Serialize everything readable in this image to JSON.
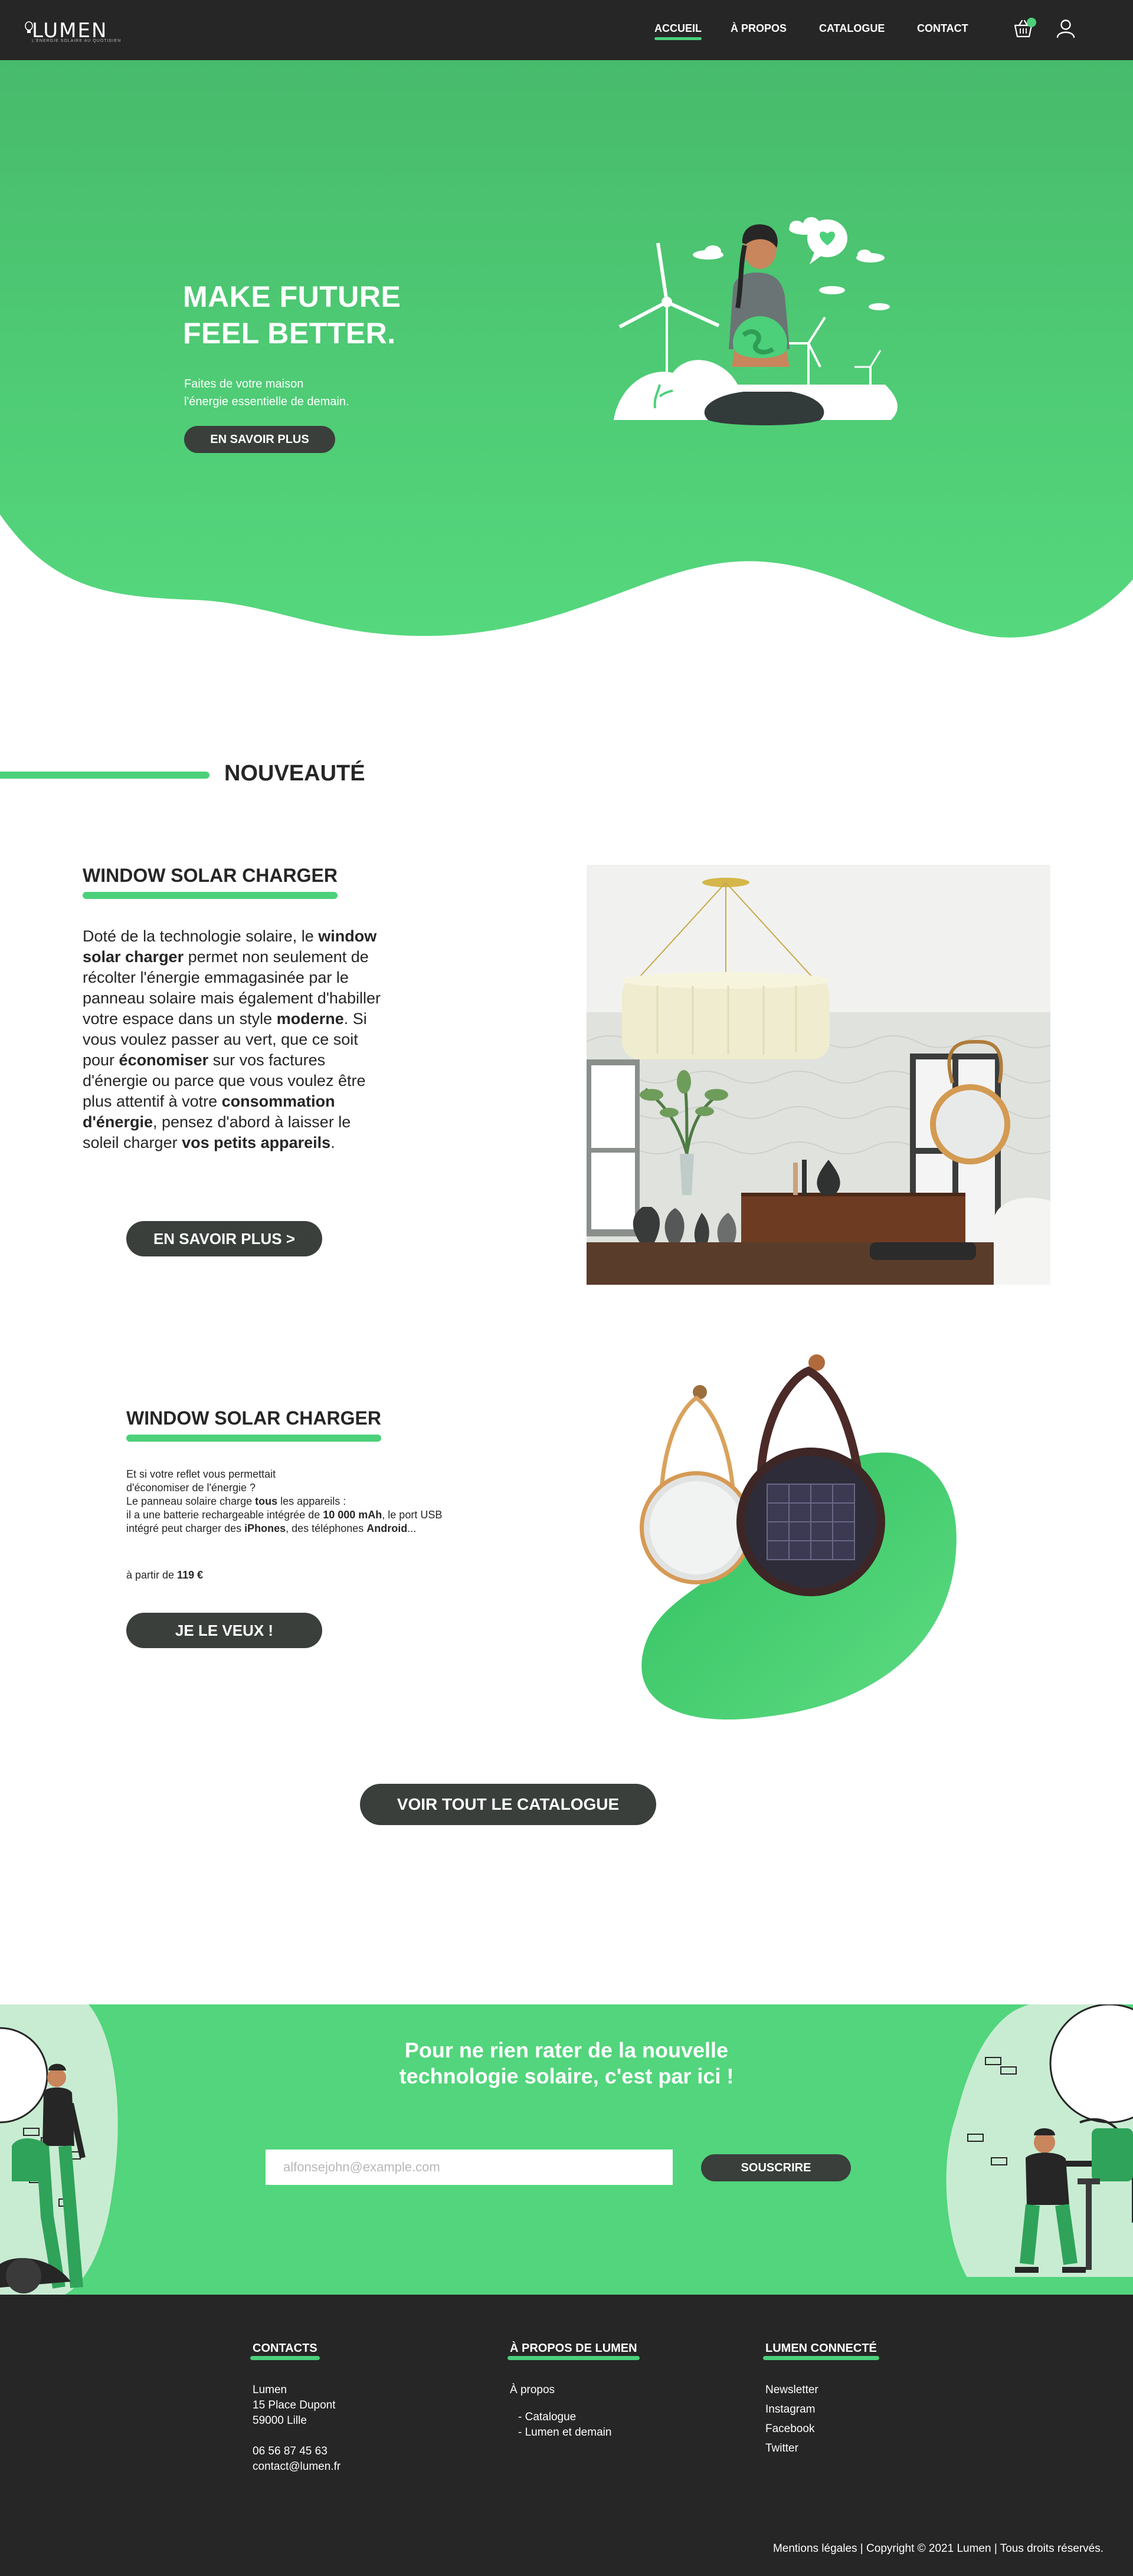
{
  "nav": {
    "logo_text": "LUMEN",
    "logo_tagline": "L'ÉNERGIE SOLAIRE AU QUOTIDIEN",
    "links": [
      "ACCUEIL",
      "À PROPOS",
      "CATALOGUE",
      "CONTACT"
    ],
    "active_link": "ACCUEIL",
    "cart_icon": "basket-icon",
    "user_icon": "user-icon"
  },
  "hero": {
    "title_line1": "MAKE FUTURE",
    "title_line2": "FEEL BETTER.",
    "subtitle_line1": "Faites de votre maison",
    "subtitle_line2": "l'énergie essentielle de demain.",
    "cta": "EN SAVOIR PLUS",
    "illustration": "woman-holding-globe-with-wind-turbines-illustration"
  },
  "section": {
    "title": "NOUVEAUTÉ"
  },
  "product1": {
    "title": "WINDOW SOLAR CHARGER",
    "desc": [
      {
        "t": "Doté de la technologie solaire, le ",
        "b": false
      },
      {
        "t": "window solar charger",
        "b": true
      },
      {
        "t": " permet non seulement de récolter l'énergie emmagasinée par le panneau solaire mais également d'habiller votre espace dans un style ",
        "b": false
      },
      {
        "t": "moderne",
        "b": true
      },
      {
        "t": ". Si vous voulez passer au vert, que ce soit pour ",
        "b": false
      },
      {
        "t": "économiser",
        "b": true
      },
      {
        "t": " sur vos factures d'énergie ou parce que vous voulez être plus attentif à votre ",
        "b": false
      },
      {
        "t": "consommation d'énergie",
        "b": true
      },
      {
        "t": ", pensez d'abord à laisser le soleil charger ",
        "b": false
      },
      {
        "t": "vos petits appareils",
        "b": true
      },
      {
        "t": ".",
        "b": false
      }
    ],
    "cta": "EN SAVOIR PLUS >",
    "photo": "interior-room-with-pendant-lamp-and-round-mirror-photo"
  },
  "product2": {
    "title": "WINDOW SOLAR CHARGER",
    "desc": [
      {
        "t": "Et si votre reflet vous permettait",
        "b": false,
        "br": true
      },
      {
        "t": "d'économiser de l'énergie ?",
        "b": false,
        "br": true
      },
      {
        "t": "Le panneau solaire charge ",
        "b": false
      },
      {
        "t": "tous",
        "b": true
      },
      {
        "t": " les appareils :",
        "b": false,
        "br": true
      },
      {
        "t": "il a une batterie rechargeable intégrée de ",
        "b": false
      },
      {
        "t": "10 000 mAh",
        "b": true
      },
      {
        "t": ", le port USB",
        "b": false,
        "br": true
      },
      {
        "t": "intégré peut charger des ",
        "b": false
      },
      {
        "t": "iPhones",
        "b": true
      },
      {
        "t": ", des téléphones ",
        "b": false
      },
      {
        "t": "Android",
        "b": true
      },
      {
        "t": "...",
        "b": false
      }
    ],
    "price_prefix": "à partir de ",
    "price": "119 €",
    "cta": "JE LE VEUX !",
    "image": "two-hanging-round-mirrors-with-solar-panel-image"
  },
  "catalog_cta": "VOIR TOUT LE CATALOGUE",
  "newsletter": {
    "title_line1": "Pour ne rien rater de la nouvelle",
    "title_line2": "technologie solaire, c'est par ici !",
    "placeholder": "alfonsejohn@example.com",
    "button": "SOUSCRIRE"
  },
  "footer": {
    "contacts": {
      "heading": "CONTACTS",
      "lines": [
        "Lumen",
        "15 Place Dupont",
        "59000 Lille"
      ],
      "phone": "06 56 87 45 63",
      "email": "contact@lumen.fr"
    },
    "about": {
      "heading": "À PROPOS DE LUMEN",
      "link": "À propos",
      "sublinks": [
        "- Catalogue",
        "- Lumen et demain"
      ]
    },
    "connected": {
      "heading": "LUMEN CONNECTÉ",
      "links": [
        "Newsletter",
        "Instagram",
        "Facebook",
        "Twitter"
      ]
    },
    "legal": {
      "mentions": "Mentions légales",
      "sep": " | ",
      "copyright": "Copyright © 2021 Lumen",
      "rights": "Tous droits réservés."
    }
  },
  "colors": {
    "green": "#4cd07a",
    "dark": "#262626",
    "button": "#3a3f3c"
  }
}
